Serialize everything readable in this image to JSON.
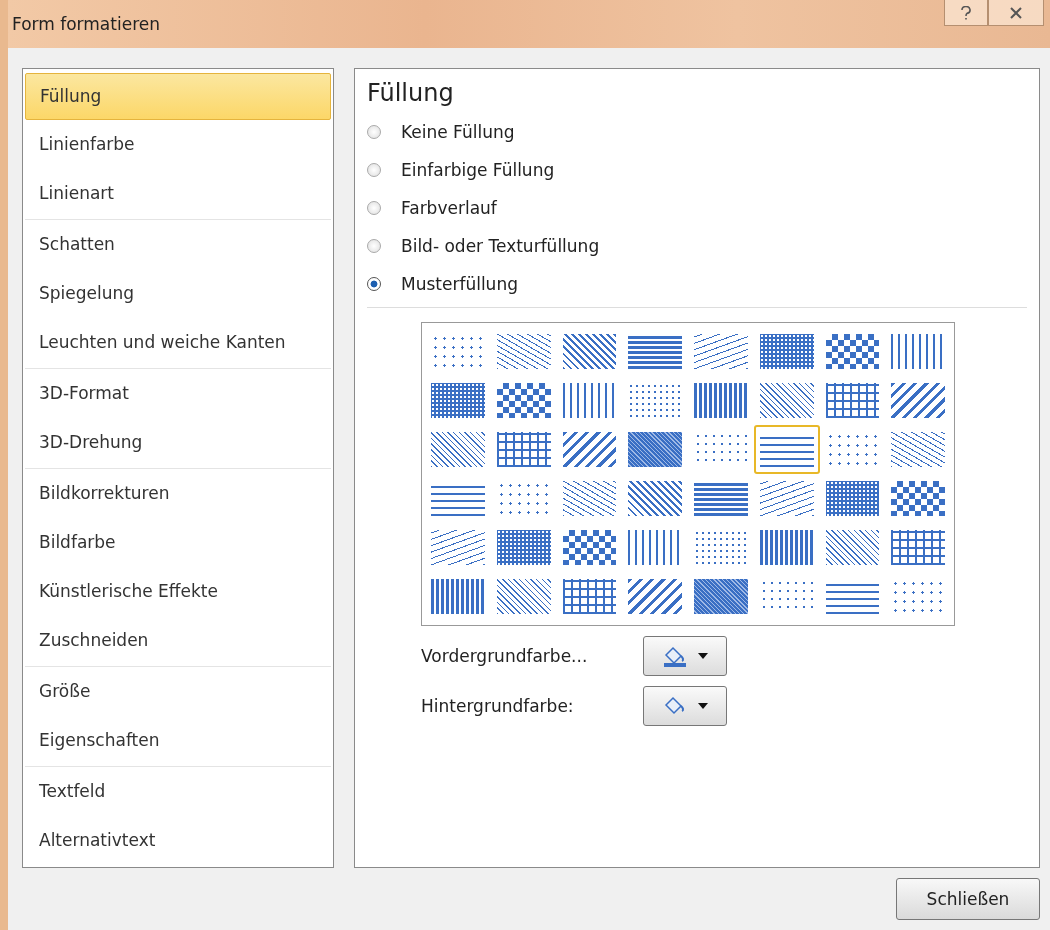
{
  "window": {
    "title": "Form formatieren"
  },
  "sidebar": {
    "groups": [
      {
        "items": [
          {
            "label": "Füllung",
            "selected": true
          },
          {
            "label": "Linienfarbe",
            "selected": false
          },
          {
            "label": "Linienart",
            "selected": false
          }
        ]
      },
      {
        "items": [
          {
            "label": "Schatten",
            "selected": false
          },
          {
            "label": "Spiegelung",
            "selected": false
          },
          {
            "label": "Leuchten und weiche Kanten",
            "selected": false
          }
        ]
      },
      {
        "items": [
          {
            "label": "3D-Format",
            "selected": false
          },
          {
            "label": "3D-Drehung",
            "selected": false
          }
        ]
      },
      {
        "items": [
          {
            "label": "Bildkorrekturen",
            "selected": false
          },
          {
            "label": "Bildfarbe",
            "selected": false
          },
          {
            "label": "Künstlerische Effekte",
            "selected": false
          },
          {
            "label": "Zuschneiden",
            "selected": false
          }
        ]
      },
      {
        "items": [
          {
            "label": "Größe",
            "selected": false
          },
          {
            "label": "Eigenschaften",
            "selected": false
          }
        ]
      },
      {
        "items": [
          {
            "label": "Textfeld",
            "selected": false
          },
          {
            "label": "Alternativtext",
            "selected": false
          }
        ]
      }
    ]
  },
  "panel": {
    "heading": "Füllung",
    "fill_options": [
      {
        "label": "Keine Füllung",
        "selected": false
      },
      {
        "label": "Einfarbige Füllung",
        "selected": false
      },
      {
        "label": "Farbverlauf",
        "selected": false
      },
      {
        "label": "Bild- oder Texturfüllung",
        "selected": false
      },
      {
        "label": "Musterfüllung",
        "selected": true
      }
    ],
    "patterns": [
      {
        "selected": false
      },
      {
        "selected": false
      },
      {
        "selected": false
      },
      {
        "selected": false
      },
      {
        "selected": false
      },
      {
        "selected": false
      },
      {
        "selected": false
      },
      {
        "selected": false
      },
      {
        "selected": false
      },
      {
        "selected": false
      },
      {
        "selected": false
      },
      {
        "selected": false
      },
      {
        "selected": false
      },
      {
        "selected": false
      },
      {
        "selected": false
      },
      {
        "selected": false
      },
      {
        "selected": false
      },
      {
        "selected": false
      },
      {
        "selected": false
      },
      {
        "selected": false
      },
      {
        "selected": false
      },
      {
        "selected": true
      },
      {
        "selected": false
      },
      {
        "selected": false
      },
      {
        "selected": false
      },
      {
        "selected": false
      },
      {
        "selected": false
      },
      {
        "selected": false
      },
      {
        "selected": false
      },
      {
        "selected": false
      },
      {
        "selected": false
      },
      {
        "selected": false
      },
      {
        "selected": false
      },
      {
        "selected": false
      },
      {
        "selected": false
      },
      {
        "selected": false
      },
      {
        "selected": false
      },
      {
        "selected": false
      },
      {
        "selected": false
      },
      {
        "selected": false
      },
      {
        "selected": false
      },
      {
        "selected": false
      },
      {
        "selected": false
      },
      {
        "selected": false
      },
      {
        "selected": false
      },
      {
        "selected": false
      },
      {
        "selected": false
      },
      {
        "selected": false
      }
    ],
    "colors": [
      {
        "label": "Vordergrundfarbe..."
      },
      {
        "label": "Hintergrundfarbe:"
      }
    ]
  },
  "buttons": {
    "close": "Schließen"
  }
}
